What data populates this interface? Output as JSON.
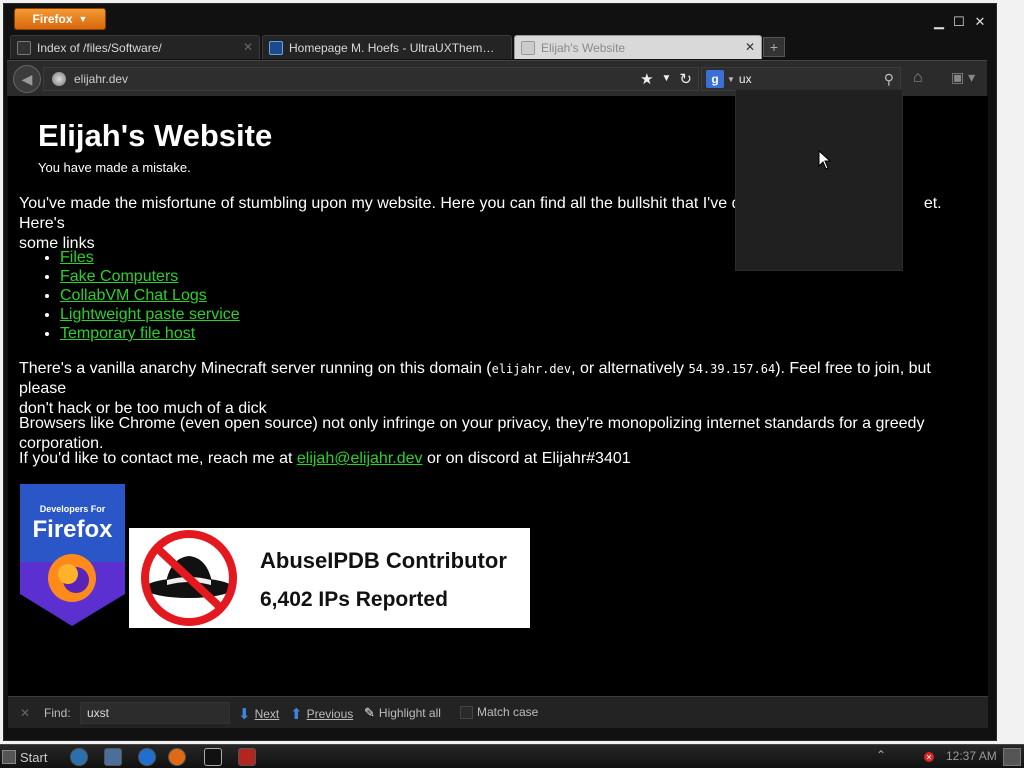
{
  "browser": {
    "menu_label": "Firefox",
    "tabs": [
      {
        "title": "Index of /files/Software/",
        "active": false
      },
      {
        "title": "Homepage M. Hoefs - UltraUXTheme...",
        "active": false
      },
      {
        "title": "Elijah's Website",
        "active": true
      }
    ],
    "url": "elijahr.dev",
    "search_value": "ux",
    "search_engine": "g"
  },
  "page": {
    "title": "Elijah's Website",
    "subtitle": "You have made a mistake.",
    "intro_a": "You've made the misfortune of stumbling upon my website. Here you can find all the bullshit that I've decid",
    "intro_b": "et. Here's",
    "intro_c": "some links",
    "links": [
      "Files",
      "Fake Computers",
      "CollabVM Chat Logs",
      "Lightweight paste service",
      "Temporary file host"
    ],
    "minecraft_1": "There's a vanilla anarchy Minecraft server running on this domain (",
    "minecraft_domain": "elijahr.dev",
    "minecraft_2": ", or alternatively ",
    "minecraft_ip": "54.39.157.64",
    "minecraft_3": "). Feel free to join, but please",
    "minecraft_4": "don't hack or be too much of a dick",
    "browsers": "Browsers like Chrome (even open source) not only infringe on your privacy, they're monopolizing internet standards for a greedy corporation.",
    "contact_1": "If you'd like to contact me, reach me at ",
    "contact_email": "elijah@elijahr.dev",
    "contact_2": " or on discord at Elijahr#3401",
    "badge_firefox_small": "Developers For",
    "badge_firefox_big": "Firefox",
    "abuse_title": "AbuseIPDB Contributor",
    "abuse_count": "6,402 IPs Reported"
  },
  "findbar": {
    "label": "Find:",
    "value": "uxst",
    "next": "Next",
    "previous": "Previous",
    "highlight": "Highlight all",
    "match_case": "Match case"
  },
  "taskbar": {
    "start": "Start",
    "clock": "12:37 AM"
  }
}
